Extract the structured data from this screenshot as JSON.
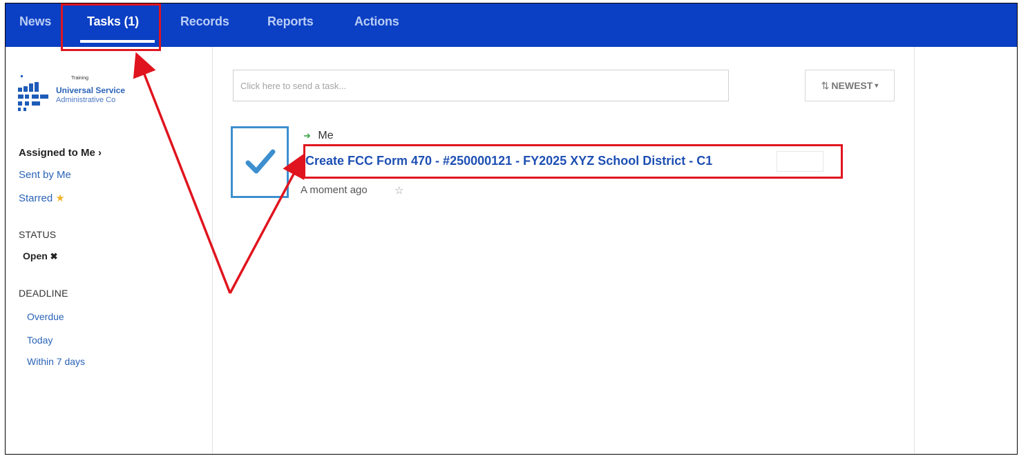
{
  "nav": {
    "tabs": [
      {
        "label": "News"
      },
      {
        "label": "Tasks (1)"
      },
      {
        "label": "Records"
      },
      {
        "label": "Reports"
      },
      {
        "label": "Actions"
      }
    ],
    "active_tab": "Tasks (1)"
  },
  "logo": {
    "small_text": "Training",
    "title": "Universal Service",
    "subtitle": "Administrative Co"
  },
  "sidebar": {
    "assigned_to_me": "Assigned to Me",
    "assigned_chevron": "›",
    "sent_by_me": "Sent by Me",
    "starred": "Starred",
    "starred_icon": "★",
    "status_heading": "STATUS",
    "status_filter": "Open",
    "status_remove_icon": "✖",
    "deadline_heading": "DEADLINE",
    "deadline_items": [
      {
        "label": "Overdue"
      },
      {
        "label": "Today"
      },
      {
        "label": "Within 7 days"
      }
    ]
  },
  "main": {
    "task_input_placeholder": "Click here to send a task...",
    "sort_icon": "⇅",
    "sort_label": "NEWEST",
    "sort_caret": "▾",
    "task": {
      "assignee": "Me",
      "title": "Create FCC Form 470 - #250000121 - FY2025 XYZ School District - C1",
      "time": "A moment ago",
      "star_icon": "☆",
      "check_icon": "✔"
    }
  },
  "colors": {
    "nav_bg": "#0b3fc4",
    "link": "#2a63b7",
    "checkbox_border": "#3d8fce",
    "annotation_red": "#e0141e"
  }
}
